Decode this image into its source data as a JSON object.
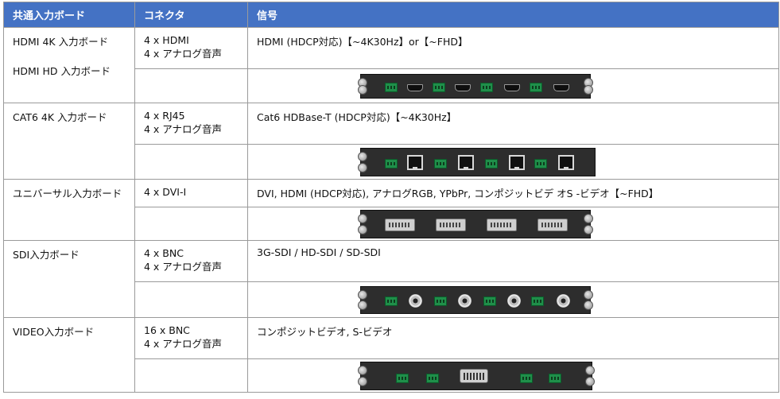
{
  "header": {
    "col1": "共通入力ボード",
    "col2": "コネクタ",
    "col3": "信号"
  },
  "rows": [
    {
      "board1": "HDMI 4K 入力ボード",
      "board2": "HDMI HD 入力ボード",
      "conn1": "4 x HDMI",
      "conn2": "4 x アナログ音声",
      "signal": "HDMI (HDCP対応)【~4K30Hz】or【~FHD】"
    },
    {
      "board1": "CAT6 4K 入力ボード",
      "conn1": "4 x RJ45",
      "conn2": "4 x アナログ音声",
      "signal": "Cat6 HDBase-T (HDCP対応)【~4K30Hz】"
    },
    {
      "board1": "ユニバーサル入力ボード",
      "conn1": "4 x DVI-I",
      "signal": "DVI, HDMI (HDCP対応), アナログRGB, YPbPr, コンポジットビデ オS -ビデオ【~FHD】"
    },
    {
      "board1": "SDI入力ボード",
      "conn1": "4 x BNC",
      "conn2": "4 x アナログ音声",
      "signal": "3G-SDI / HD-SDI / SD-SDI"
    },
    {
      "board1": "VIDEO入力ボード",
      "conn1": "16 x BNC",
      "conn2": "4 x アナログ音声",
      "signal": "コンポジットビデオ, S-ビデオ"
    }
  ]
}
